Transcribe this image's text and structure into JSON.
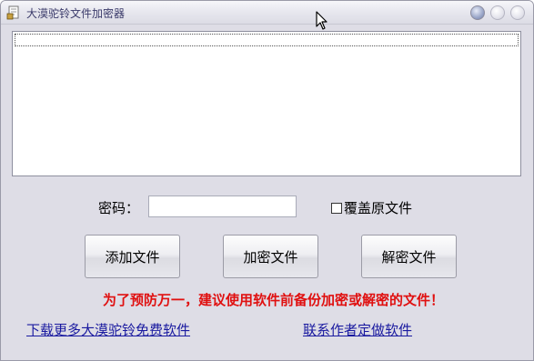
{
  "window": {
    "title": "大漠驼铃文件加密器"
  },
  "form": {
    "password_label": "密码：",
    "password_value": "",
    "overwrite_label": "覆盖原文件",
    "overwrite_checked": false
  },
  "buttons": {
    "add_file": "添加文件",
    "encrypt_file": "加密文件",
    "decrypt_file": "解密文件"
  },
  "warning_text": "为了预防万一，建议使用软件前备份加密或解密的文件！",
  "links": {
    "download_more": "下载更多大漠驼铃免费软件",
    "contact_author": "联系作者定做软件"
  },
  "colors": {
    "warning": "#e01010",
    "link": "#1a1aa0",
    "window_bg": "#dedde6"
  }
}
